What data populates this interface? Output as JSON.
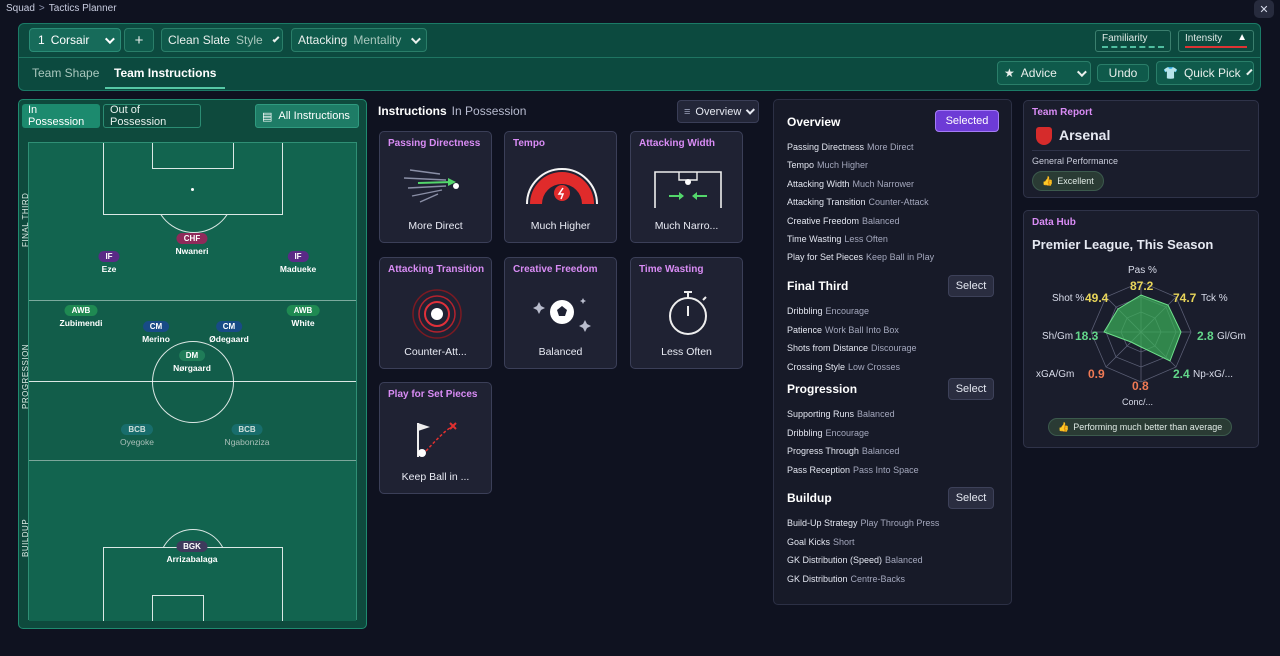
{
  "breadcrumb": {
    "root": "Squad",
    "current": "Tactics Planner"
  },
  "topbar": {
    "tactic_number": "1",
    "tactic_name": "Corsair",
    "add_label": "+",
    "style_value": "Clean Slate",
    "style_label": "Style",
    "mentality_value": "Attacking",
    "mentality_label": "Mentality",
    "familiarity_label": "Familiarity",
    "intensity_label": "Intensity",
    "intensity_warning": "!"
  },
  "tabs": {
    "shape": "Team Shape",
    "instructions": "Team Instructions"
  },
  "actions": {
    "advice": "Advice",
    "undo": "Undo",
    "quick_pick": "Quick Pick"
  },
  "pitch": {
    "tab_in": "In Possession",
    "tab_out": "Out of Possession",
    "all_instructions": "All Instructions",
    "zones": [
      "FINAL THIRD",
      "PROGRESSION",
      "BUILDUP"
    ],
    "players": [
      {
        "role": "CHF",
        "name": "Nwaneri",
        "color": "pink"
      },
      {
        "role": "IF",
        "name": "Eze",
        "color": "purple"
      },
      {
        "role": "IF",
        "name": "Madueke",
        "color": "purple"
      },
      {
        "role": "AWB",
        "name": "Zubimendi",
        "color": "green"
      },
      {
        "role": "AWB",
        "name": "White",
        "color": "green"
      },
      {
        "role": "CM",
        "name": "Merino",
        "color": "blue"
      },
      {
        "role": "CM",
        "name": "Ødegaard",
        "color": "blue"
      },
      {
        "role": "DM",
        "name": "Nørgaard",
        "color": "dm"
      },
      {
        "role": "BCB",
        "name": "Oyegoke",
        "color": "teal"
      },
      {
        "role": "BCB",
        "name": "Ngabonziza",
        "color": "teal"
      },
      {
        "role": "BGK",
        "name": "Arrizabalaga",
        "color": "gray"
      }
    ]
  },
  "instructions": {
    "title": "Instructions",
    "subtitle": "In Possession",
    "overview_btn": "Overview",
    "cards": [
      {
        "title": "Passing Directness",
        "value": "More Direct"
      },
      {
        "title": "Tempo",
        "value": "Much Higher"
      },
      {
        "title": "Attacking Width",
        "value": "Much Narro..."
      },
      {
        "title": "Attacking Transition",
        "value": "Counter-Att..."
      },
      {
        "title": "Creative Freedom",
        "value": "Balanced"
      },
      {
        "title": "Time Wasting",
        "value": "Less Often"
      },
      {
        "title": "Play for Set Pieces",
        "value": "Keep Ball in ..."
      }
    ]
  },
  "overview": {
    "sections": [
      {
        "title": "Overview",
        "button": "Selected",
        "rows": [
          [
            "Passing Directness",
            "More Direct"
          ],
          [
            "Tempo",
            "Much Higher"
          ],
          [
            "Attacking Width",
            "Much Narrower"
          ],
          [
            "Attacking Transition",
            "Counter-Attack"
          ],
          [
            "Creative Freedom",
            "Balanced"
          ],
          [
            "Time Wasting",
            "Less Often"
          ],
          [
            "Play for Set Pieces",
            "Keep Ball in Play"
          ]
        ]
      },
      {
        "title": "Final Third",
        "button": "Select",
        "rows": [
          [
            "Dribbling",
            "Encourage"
          ],
          [
            "Patience",
            "Work Ball Into Box"
          ],
          [
            "Shots from Distance",
            "Discourage"
          ],
          [
            "Crossing Style",
            "Low Crosses"
          ]
        ]
      },
      {
        "title": "Progression",
        "button": "Select",
        "rows": [
          [
            "Supporting Runs",
            "Balanced"
          ],
          [
            "Dribbling",
            "Encourage"
          ],
          [
            "Progress Through",
            "Balanced"
          ],
          [
            "Pass Reception",
            "Pass Into Space"
          ]
        ]
      },
      {
        "title": "Buildup",
        "button": "Select",
        "rows": [
          [
            "Build-Up Strategy",
            "Play Through Press"
          ],
          [
            "Goal Kicks",
            "Short"
          ],
          [
            "GK Distribution (Speed)",
            "Balanced"
          ],
          [
            "GK Distribution",
            "Centre-Backs"
          ]
        ]
      }
    ]
  },
  "team_report": {
    "title": "Team Report",
    "team": "Arsenal",
    "perf_label": "General Performance",
    "perf_value": "Excellent"
  },
  "data_hub": {
    "title": "Data Hub",
    "competition": "Premier League, This Season",
    "stats": [
      {
        "label": "Pas %",
        "value": "87.2",
        "color": "#e8d55a"
      },
      {
        "label": "Tck %",
        "value": "74.7",
        "color": "#e8d55a"
      },
      {
        "label": "Gl/Gm",
        "value": "2.8",
        "color": "#63d68a"
      },
      {
        "label": "Np-xG/...",
        "value": "2.4",
        "color": "#63d68a"
      },
      {
        "label": "Conc/...",
        "value": "0.8",
        "color": "#f07a55"
      },
      {
        "label": "xGA/Gm",
        "value": "0.9",
        "color": "#f07a55"
      },
      {
        "label": "Sh/Gm",
        "value": "18.3",
        "color": "#63d68a"
      },
      {
        "label": "Shot %",
        "value": "49.4",
        "color": "#e8d55a"
      }
    ],
    "footer": "Performing much better than average"
  }
}
